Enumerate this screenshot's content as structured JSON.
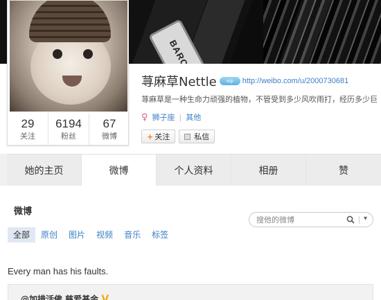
{
  "cover": {
    "text": "BARC"
  },
  "profile": {
    "name": "荨麻草Nettle",
    "badge": "vip",
    "url": "http://weibo.com/u/2000730681",
    "bio": "荨麻草是一种生命力顽强的植物，不管受到多少风吹雨打，经历多少巨",
    "gender_symbol": "♀",
    "tags": [
      "狮子座",
      "其他"
    ],
    "follow_label": "关注",
    "message_label": "私信"
  },
  "stats": [
    {
      "num": "29",
      "label": "关注"
    },
    {
      "num": "6194",
      "label": "粉丝"
    },
    {
      "num": "67",
      "label": "微博"
    }
  ],
  "tabs": [
    {
      "label": "她的主页"
    },
    {
      "label": "微博"
    },
    {
      "label": "个人资料"
    },
    {
      "label": "相册"
    },
    {
      "label": "赞"
    }
  ],
  "feed": {
    "title": "微博",
    "search_placeholder": "搜他的微博",
    "filters": [
      "全部",
      "原创",
      "图片",
      "视频",
      "音乐",
      "标签"
    ],
    "post_text": "Every man has his faults.",
    "repost_author": "@加措活佛 慈爱基金",
    "repost_badge": "V"
  },
  "colors": {
    "link": "#3b7fc4",
    "accent": "#f77c10"
  }
}
